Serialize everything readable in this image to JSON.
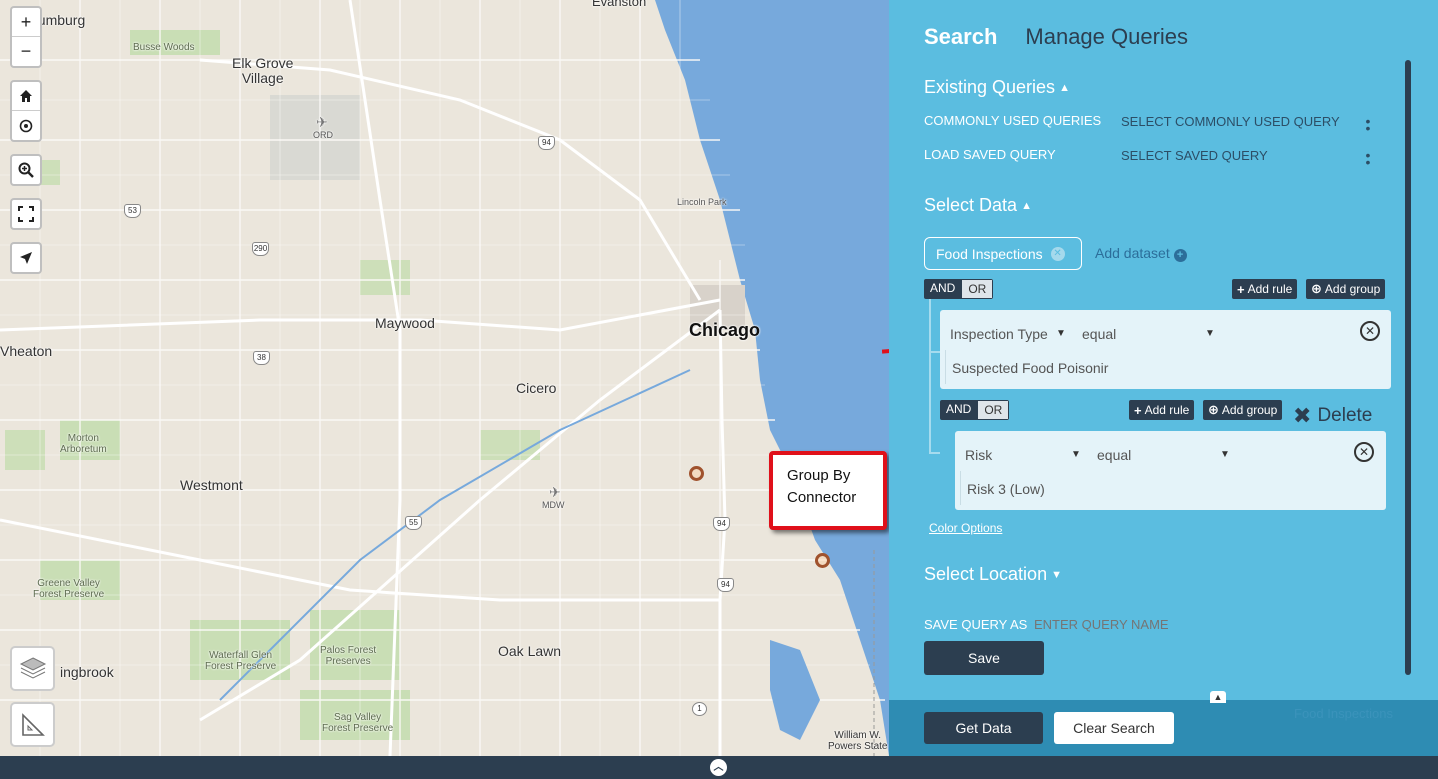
{
  "map": {
    "labels": {
      "schaumburg": "aumburg",
      "evanston": "Evanston",
      "busse_woods": "Busse Woods",
      "elk_grove": "Elk Grove\nVillage",
      "ord": "ORD",
      "lincoln_park": "Lincoln Park",
      "chicago": "Chicago",
      "maywood": "Maywood",
      "wheaton": "Vheaton",
      "cicero": "Cicero",
      "morton": "Morton\nArboretum",
      "westmont": "Westmont",
      "mdw": "MDW",
      "greene_valley": "Greene Valley\nForest Preserve",
      "waterfall_glen": "Waterfall Glen\nForest Preserve",
      "palos": "Palos Forest\nPreserves",
      "bolingbrook": "ingbrook",
      "oak_lawn": "Oak Lawn",
      "sag_valley": "Sag Valley\nForest Preserve",
      "williams": "William W.\nPowers State"
    },
    "shields": {
      "s94a": "94",
      "s53": "53",
      "s290": "290",
      "s38": "38",
      "s55": "55",
      "s94b": "94",
      "s94c": "94",
      "s1": "1"
    },
    "controls": {
      "zoom_in": "+",
      "zoom_out": "−"
    }
  },
  "callout": {
    "text": "Group By\nConnector"
  },
  "panel": {
    "tabs": [
      "Search",
      "Manage Queries"
    ],
    "existing_queries": {
      "title": "Existing Queries",
      "commonly_used_label": "COMMONLY USED QUERIES",
      "commonly_used_value": "SELECT COMMONLY USED QUERY",
      "load_saved_label": "LOAD SAVED QUERY",
      "load_saved_value": "SELECT SAVED QUERY"
    },
    "select_data": {
      "title": "Select Data",
      "dataset": "Food Inspections",
      "add_dataset": "Add dataset",
      "and_label": "AND",
      "or_label": "OR",
      "add_rule": "Add rule",
      "add_group": "Add group",
      "rule1": {
        "field": "Inspection Type",
        "operator": "equal",
        "value": "Suspected Food Poisonir"
      },
      "rule2": {
        "field": "Risk",
        "operator": "equal",
        "value": "Risk 3 (Low)"
      },
      "delete_label": "Delete",
      "color_options": "Color Options"
    },
    "select_location": {
      "title": "Select Location"
    },
    "save": {
      "label": "SAVE QUERY AS",
      "placeholder": "ENTER QUERY NAME",
      "button": "Save"
    }
  },
  "action_bar": {
    "get_data": "Get Data",
    "clear_search": "Clear Search",
    "legend_faded": "Food Inspections"
  },
  "colors": {
    "panel_bg": "#5bbde0",
    "dark": "#2c3e50",
    "action_bar": "#2e8cb3",
    "callout_border": "#e0101a",
    "marker": "#a0522d"
  }
}
